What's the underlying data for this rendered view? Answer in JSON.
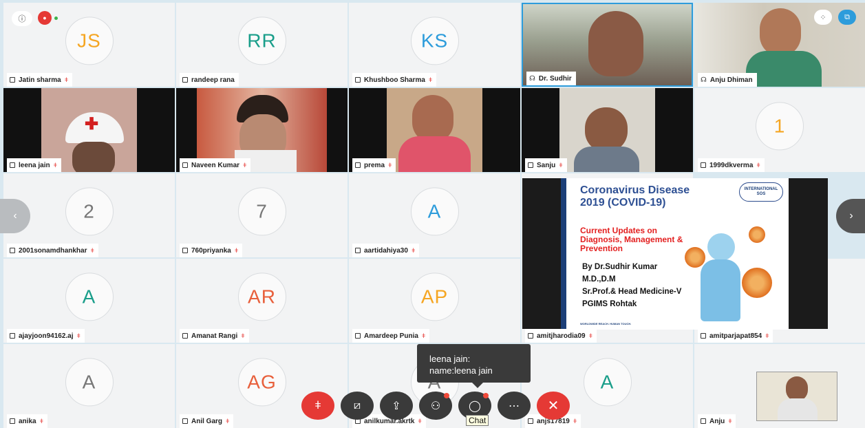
{
  "tiles": [
    {
      "name": "Jatin sharma",
      "initials": "JS",
      "color": "#f5a623",
      "muted": true
    },
    {
      "name": "randeep rana",
      "initials": "RR",
      "color": "#1a9e8a",
      "muted": false
    },
    {
      "name": "Khushboo Sharma",
      "initials": "KS",
      "color": "#2d9cdb",
      "muted": true
    },
    {
      "name": "Dr. Sudhir",
      "video": true,
      "headset": true
    },
    {
      "name": "Anju Dhiman",
      "video": true,
      "headset": true
    },
    {
      "name": "leena jain",
      "video": true,
      "muted": true
    },
    {
      "name": "Naveen Kumar",
      "video": true,
      "muted": true
    },
    {
      "name": "prema",
      "video": true,
      "muted": true
    },
    {
      "name": "Sanju",
      "video": true,
      "muted": true
    },
    {
      "name": "1999dkverma",
      "initials": "1",
      "color": "#f5a623",
      "muted": true
    },
    {
      "name": "2001sonamdhankhar",
      "initials": "2",
      "color": "#777777",
      "muted": true
    },
    {
      "name": "760priyanka",
      "initials": "7",
      "color": "#777777",
      "muted": true
    },
    {
      "name": "aartidahiya30",
      "initials": "A",
      "color": "#2d9cdb",
      "muted": true
    },
    {
      "name": "amitjharodia09",
      "slide": true,
      "muted": true
    },
    {
      "name": "ajayjoon94162.aj",
      "initials": "A",
      "color": "#1a9e8a",
      "muted": true
    },
    {
      "name": "Amanat Rangi",
      "initials": "AR",
      "color": "#e8603c",
      "muted": true
    },
    {
      "name": "Amardeep Punia",
      "initials": "AP",
      "color": "#f5a623",
      "muted": true
    },
    {
      "name": "amitparjapat854",
      "muted": true
    },
    {
      "name": "anika",
      "initials": "A",
      "color": "#777777",
      "muted": true
    },
    {
      "name": "Anil Garg",
      "initials": "AG",
      "color": "#e8603c",
      "muted": true
    },
    {
      "name": "anilkumar.akrtk",
      "initials": "A",
      "color": "#777777",
      "muted": true
    },
    {
      "name": "anjs17819",
      "initials": "A",
      "color": "#1a9e8a",
      "muted": true
    },
    {
      "name": "Anju",
      "muted": true
    }
  ],
  "slide": {
    "title": "Coronavirus Disease 2019 (COVID-19)",
    "subtitle": "Current Updates on Diagnosis, Management & Prevention",
    "author_lines": [
      "By Dr.Sudhir Kumar",
      "M.D.,D.M",
      "Sr.Prof.& Head Medicine-V",
      "PGIMS Rohtak"
    ],
    "logo": "INTERNATIONAL SOS",
    "footer": "WORLDWIDE REACH. HUMAN TOUCH."
  },
  "tooltip": {
    "line1": "leena jain:",
    "line2": "name:leena jain"
  },
  "chat_label": "Chat",
  "colors": {
    "mute_red": "#e53935",
    "toolbar": "#3a3a3a",
    "background": "#d9e8f0"
  },
  "icons": [
    "info-icon",
    "record-icon",
    "layout-grid-icon",
    "pin-icon",
    "mic-off-icon",
    "video-off-icon",
    "share-icon",
    "participants-icon",
    "chat-icon",
    "more-icon",
    "close-icon",
    "chevron-left-icon",
    "chevron-right-icon"
  ]
}
